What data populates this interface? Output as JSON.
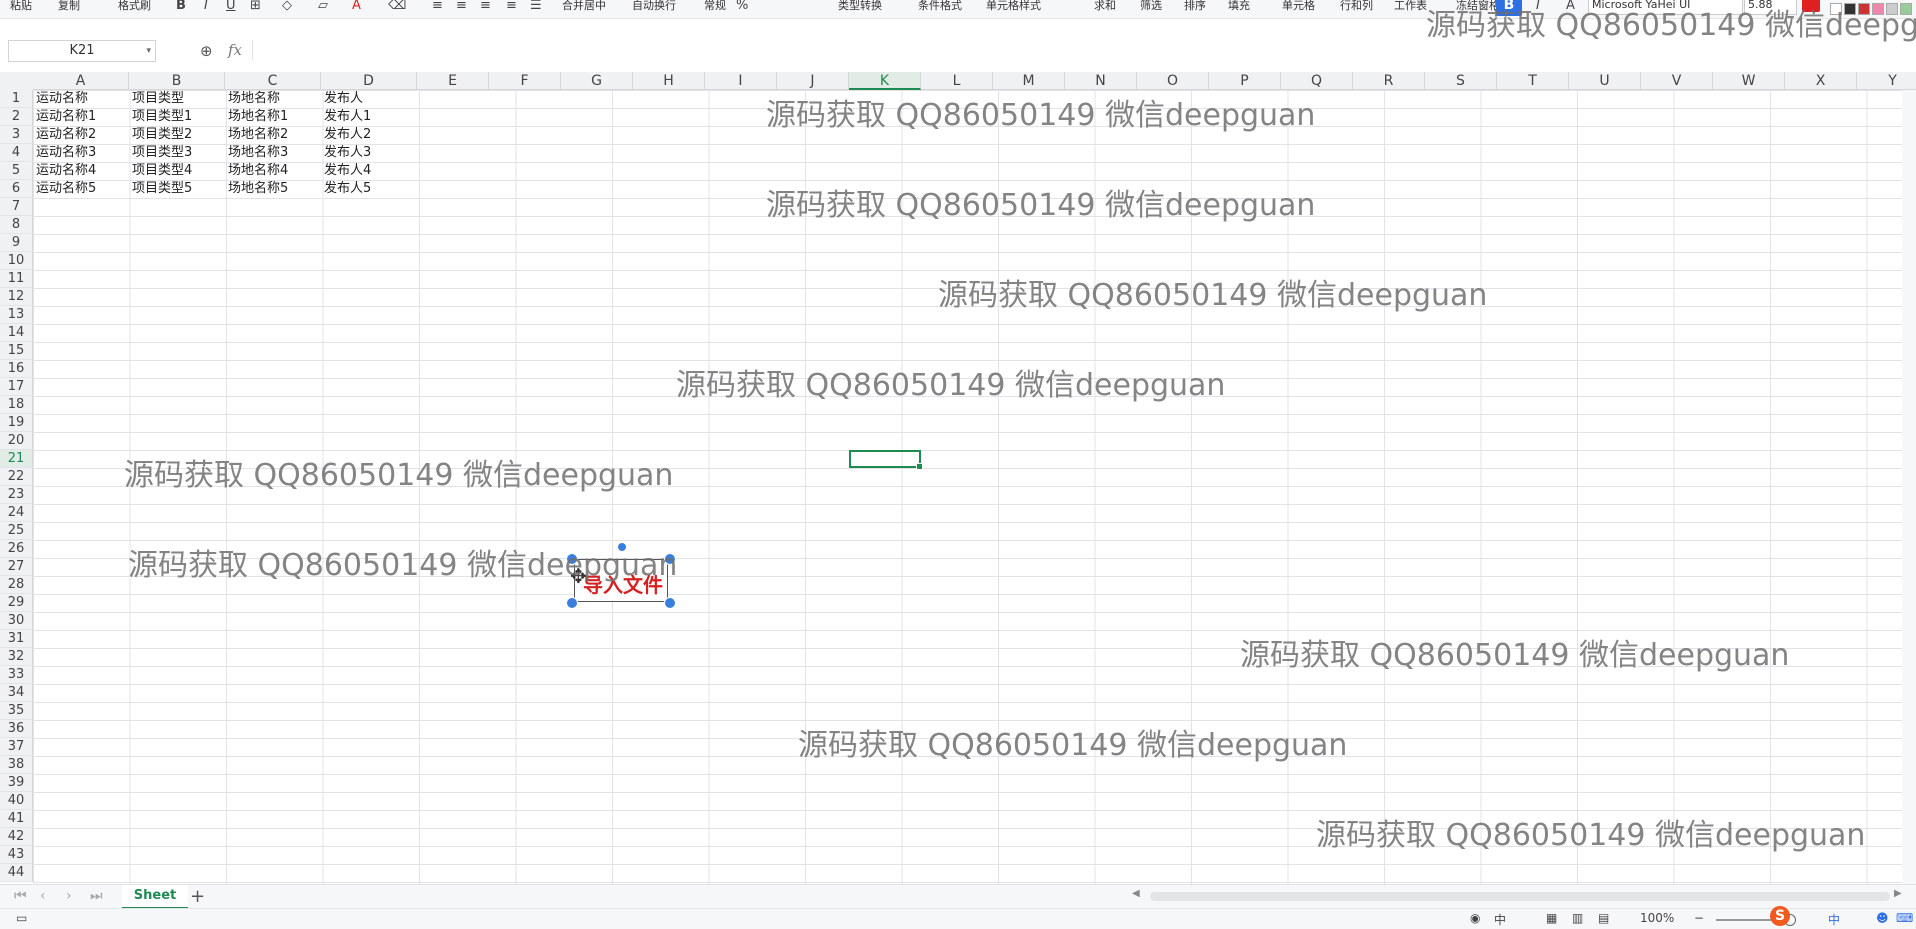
{
  "toolbar": {
    "items": [
      "粘贴",
      "复制",
      "格式刷",
      "合并居中",
      "自动换行",
      "常规",
      "类型转换",
      "条件格式",
      "单元格样式",
      "求和",
      "筛选",
      "排序",
      "填充",
      "单元格",
      "行和列",
      "工作表",
      "冻结窗格"
    ],
    "font_name": "Microsoft YaHei UI",
    "font_size": "5.88",
    "bold_label": "B",
    "italic_label": "I",
    "underline_label": "U",
    "percent_label": "%",
    "accent_color": "#2f6fe4",
    "font_color": "#e02020"
  },
  "formula_bar": {
    "name_box": "K21",
    "fx_label": "fx",
    "formula": ""
  },
  "grid": {
    "columns": [
      "A",
      "B",
      "C",
      "D",
      "E",
      "F",
      "G",
      "H",
      "I",
      "J",
      "K",
      "L",
      "M",
      "N",
      "O",
      "P",
      "Q",
      "R",
      "S",
      "T",
      "U",
      "V",
      "W",
      "X",
      "Y"
    ],
    "active_column": "K",
    "rows": [
      "1",
      "2",
      "3",
      "4",
      "5",
      "6",
      "7",
      "8",
      "9",
      "10",
      "11",
      "12",
      "13",
      "14",
      "15",
      "16",
      "17",
      "18",
      "19",
      "20",
      "21",
      "22",
      "23",
      "24",
      "25",
      "26",
      "27",
      "28",
      "29",
      "30",
      "31",
      "32",
      "33",
      "34",
      "35",
      "36",
      "37",
      "38",
      "39",
      "40",
      "41",
      "42",
      "43",
      "44"
    ],
    "active_row": "21",
    "table": {
      "headers": [
        "运动名称",
        "项目类型",
        "场地名称",
        "发布人"
      ],
      "rows": [
        [
          "运动名称1",
          "项目类型1",
          "场地名称1",
          "发布人1"
        ],
        [
          "运动名称2",
          "项目类型2",
          "场地名称2",
          "发布人2"
        ],
        [
          "运动名称3",
          "项目类型3",
          "场地名称3",
          "发布人3"
        ],
        [
          "运动名称4",
          "项目类型4",
          "场地名称4",
          "发布人4"
        ],
        [
          "运动名称5",
          "项目类型5",
          "场地名称5",
          "发布人5"
        ]
      ]
    }
  },
  "import_button": {
    "label": "导入文件",
    "color": "#d42222"
  },
  "watermark": "源码获取 QQ86050149 微信deepguan",
  "sheet_bar": {
    "sheet_name": "Sheet",
    "add_label": "+"
  },
  "status_bar": {
    "zoom": "100%",
    "input_method": "中",
    "ime_label": "中"
  }
}
